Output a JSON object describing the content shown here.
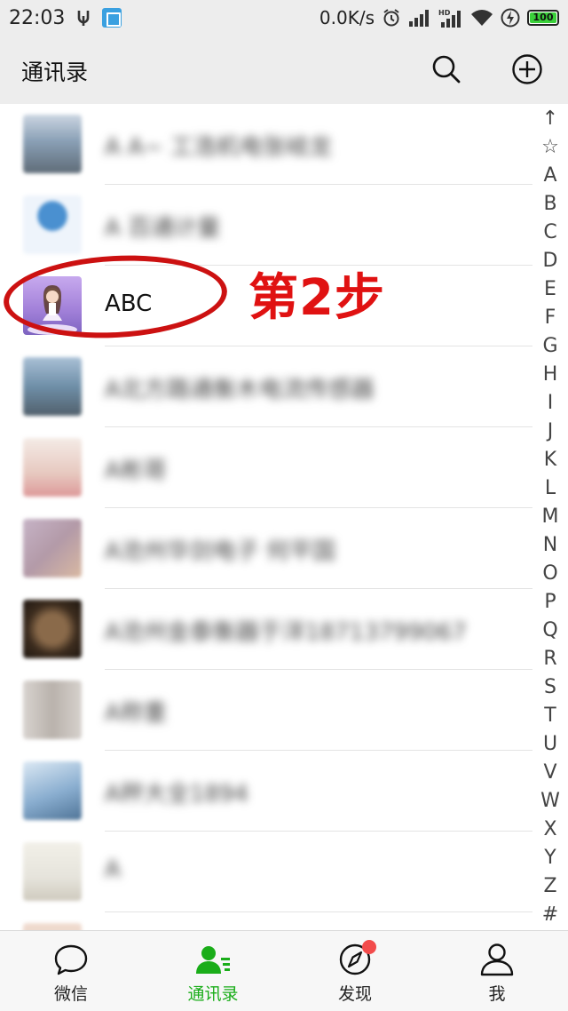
{
  "status_bar": {
    "time": "22:03",
    "network_speed": "0.0K/s",
    "battery": "100",
    "icons": [
      "usb-icon",
      "app-notification-icon",
      "alarm-icon",
      "signal-icon",
      "hd-signal-icon",
      "wifi-icon",
      "charging-icon",
      "battery-icon"
    ]
  },
  "header": {
    "title": "通讯录",
    "search_icon": "search-icon",
    "add_icon": "add-circle-icon"
  },
  "contacts": [
    {
      "name": "A A~ 工浩机电张岐龙",
      "blurred": true,
      "avatar_color": "#6a7d94"
    },
    {
      "name": "A 百通计量",
      "blurred": true,
      "avatar_color": "#2e6fb0"
    },
    {
      "name": "ABC",
      "blurred": false,
      "avatar_color": "#b88fe0"
    },
    {
      "name": "A北方路通衡木电流传感器",
      "blurred": true,
      "avatar_color": "#6f8fa8"
    },
    {
      "name": "A彬哥",
      "blurred": true,
      "avatar_color": "#e7c9c0"
    },
    {
      "name": "A沧州华剑电子 何平国",
      "blurred": true,
      "avatar_color": "#b39aa8"
    },
    {
      "name": "A沧州金泰衡器于洋18713799067",
      "blurred": true,
      "avatar_color": "#4a3a2a"
    },
    {
      "name": "A称重",
      "blurred": true,
      "avatar_color": "#c9c2bd"
    },
    {
      "name": "A秤大全1894",
      "blurred": true,
      "avatar_color": "#8aaed0"
    },
    {
      "name": "A",
      "blurred": true,
      "avatar_color": "#e6e4dc"
    }
  ],
  "index": [
    "↑",
    "☆",
    "A",
    "B",
    "C",
    "D",
    "E",
    "F",
    "G",
    "H",
    "I",
    "J",
    "K",
    "L",
    "M",
    "N",
    "O",
    "P",
    "Q",
    "R",
    "S",
    "T",
    "U",
    "V",
    "W",
    "X",
    "Y",
    "Z",
    "#"
  ],
  "annotation": {
    "step_text": "第2步",
    "color": "#e01212"
  },
  "bottom_nav": {
    "items": [
      {
        "label": "微信",
        "icon": "chat-bubble-icon",
        "active": false
      },
      {
        "label": "通讯录",
        "icon": "contacts-icon",
        "active": true
      },
      {
        "label": "发现",
        "icon": "compass-icon",
        "active": false,
        "badge": true
      },
      {
        "label": "我",
        "icon": "person-icon",
        "active": false
      }
    ]
  },
  "colors": {
    "accent": "#1aad19",
    "badge": "#f24b4b",
    "header_bg": "#ededed"
  }
}
